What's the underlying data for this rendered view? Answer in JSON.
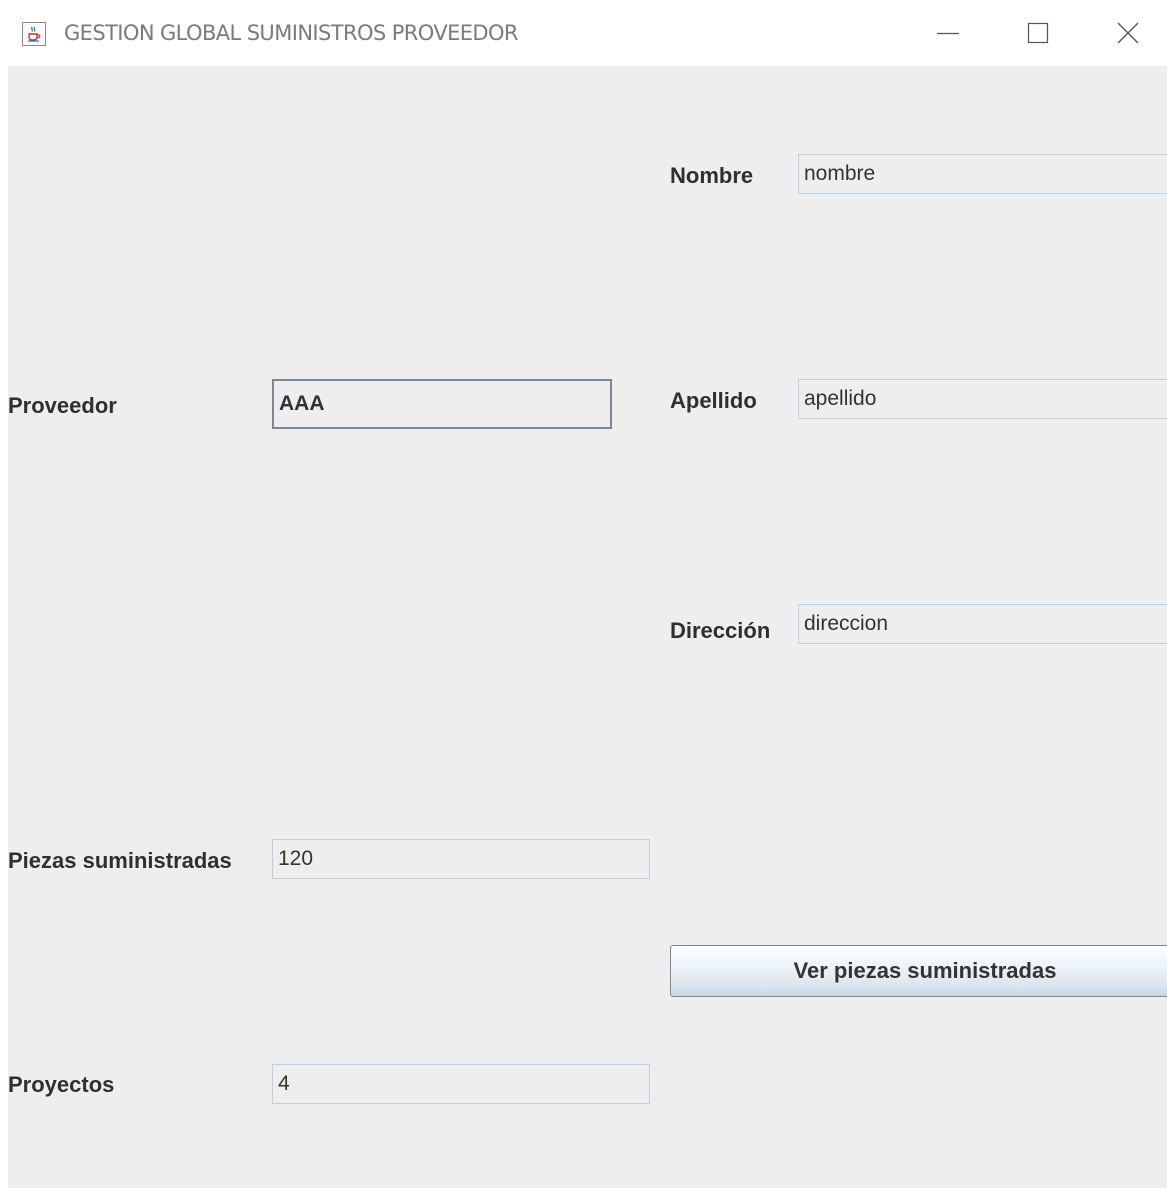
{
  "window": {
    "title": "GESTION GLOBAL SUMINISTROS PROVEEDOR",
    "icon": "java-cup-icon",
    "controls": [
      "minimize-icon",
      "maximize-icon",
      "close-icon"
    ]
  },
  "form": {
    "proveedor": {
      "label": "Proveedor",
      "value": "AAA"
    },
    "nombre": {
      "label": "Nombre",
      "value": "nombre"
    },
    "apellido": {
      "label": "Apellido",
      "value": "apellido"
    },
    "direccion": {
      "label": "Dirección",
      "value": "direccion"
    },
    "piezas": {
      "label": "Piezas suministradas",
      "value": "120"
    },
    "proyectos": {
      "label": "Proyectos",
      "value": "4"
    }
  },
  "actions": {
    "ver_piezas_label": "Ver piezas suministradas"
  },
  "colors": {
    "panel_bg": "#eeeeee",
    "field_border": "#b8cfe5",
    "label_text": "#2f2f2f"
  }
}
